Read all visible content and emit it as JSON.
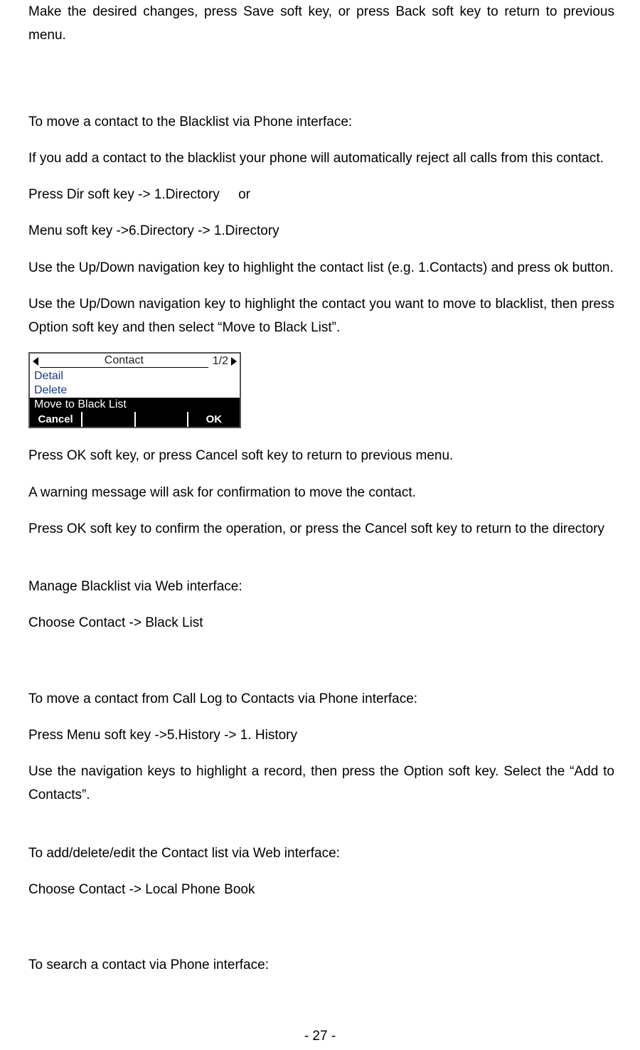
{
  "p1": "Make the desired changes, press Save soft key, or press Back soft key to return to previous menu.",
  "p2": "To move a contact to the Blacklist via Phone interface:",
  "p3": "If you add a contact to the blacklist your phone will automatically reject all calls from this contact.",
  "p4": "Press Dir soft key -> 1.Directory     or",
  "p5": "Menu soft key ->6.Directory -> 1.Directory",
  "p6": "Use the Up/Down navigation key to highlight the contact list (e.g. 1.Contacts) and press ok button.",
  "p7": "Use the Up/Down navigation key to highlight the contact you want to move to blacklist, then press Option soft key and then select “Move to Black List”.",
  "lcd": {
    "title": "Contact",
    "count": "1/2",
    "row1": "Detail",
    "row2": "Delete",
    "row3": "Move to Black List",
    "soft_left": "Cancel",
    "soft_right": "OK"
  },
  "p8": "Press OK soft key, or press Cancel soft key to return to previous menu.",
  "p9": "A warning message will ask for confirmation to move the contact.",
  "p10": "Press OK soft key to confirm the operation, or press the Cancel soft key to return to the directory",
  "p11": "Manage Blacklist via Web interface:",
  "p12": "Choose Contact -> Black List",
  "p13": "To move a contact from Call Log to Contacts via Phone interface:",
  "p14": "Press Menu soft key ->5.History -> 1. History",
  "p15": "Use the navigation keys to highlight a record, then press the Option soft key. Select the “Add to Contacts”.",
  "p16": "To add/delete/edit the Contact list via Web interface:",
  "p17": "Choose Contact -> Local Phone Book",
  "p18": "To search a contact via Phone interface:",
  "footer": "- 27 -"
}
